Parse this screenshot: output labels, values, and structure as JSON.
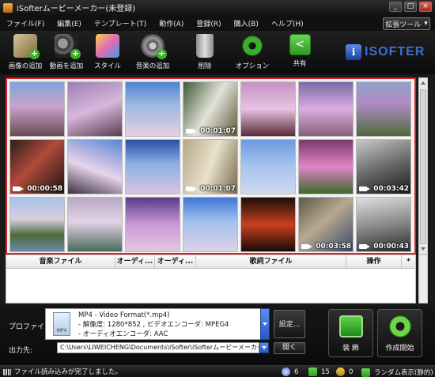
{
  "window": {
    "title": "iSofterムービーメーカー(未登録)",
    "minimize": "_",
    "maximize": "□",
    "close": "×"
  },
  "menu": [
    "ファイル(F)",
    "編集(E)",
    "テンプレート(T)",
    "動作(A)",
    "登録(R)",
    "購入(B)",
    "ヘルプ(H)"
  ],
  "ext_tools": {
    "label": "拡張ツール",
    "arrow": "▾"
  },
  "toolbar": [
    {
      "label": "画像の追加",
      "icon": "add-image-icon"
    },
    {
      "label": "動画を追加",
      "icon": "add-video-icon"
    },
    {
      "label": "スタイル",
      "icon": "style-icon"
    },
    {
      "label": "音楽の追加",
      "icon": "add-music-icon"
    },
    {
      "label": "削除",
      "icon": "trash-icon"
    },
    {
      "label": "オプション",
      "icon": "gear-icon"
    },
    {
      "label": "共有",
      "icon": "share-icon"
    }
  ],
  "logo": {
    "badge": "i",
    "text": "ISOFTER"
  },
  "media": [
    [
      {
        "type": "image",
        "duration": ""
      },
      {
        "type": "image",
        "duration": ""
      },
      {
        "type": "image",
        "duration": ""
      },
      {
        "type": "video",
        "duration": "00:01:07"
      },
      {
        "type": "image",
        "duration": ""
      },
      {
        "type": "image",
        "duration": ""
      },
      {
        "type": "image",
        "duration": ""
      }
    ],
    [
      {
        "type": "video",
        "duration": "00:00:58"
      },
      {
        "type": "image",
        "duration": ""
      },
      {
        "type": "image",
        "duration": ""
      },
      {
        "type": "video",
        "duration": "00:01:07"
      },
      {
        "type": "image",
        "duration": ""
      },
      {
        "type": "image",
        "duration": ""
      },
      {
        "type": "video",
        "duration": "00:03:42"
      }
    ],
    [
      {
        "type": "image",
        "duration": ""
      },
      {
        "type": "image",
        "duration": ""
      },
      {
        "type": "image",
        "duration": ""
      },
      {
        "type": "image",
        "duration": ""
      },
      {
        "type": "image",
        "duration": ""
      },
      {
        "type": "video",
        "duration": "00:03:58"
      },
      {
        "type": "video",
        "duration": "00:00:43"
      }
    ]
  ],
  "music_table": {
    "columns": [
      "音楽ファイル",
      "オーディ...",
      "オーディ...",
      "歌詞ファイル",
      "操作",
      "*"
    ]
  },
  "profile": {
    "label": "プロファイル:",
    "lines": [
      "MP4 - Video Format(*.mp4)",
      "- 解像度: 1280*852 , ビデオエンコーダ: MPEG4",
      "- オーディオエンコーダ: AAC"
    ],
    "icon_text": "MP4",
    "settings_label": "設定..."
  },
  "output": {
    "label": "出力先:",
    "path": "C:\\Users\\LIWEICHENG\\Documents\\iSofter\\iSofterムービーメーカー出力\\",
    "open_label": "開く"
  },
  "actions": {
    "decorate": "装 飾",
    "start": "作成開始"
  },
  "status": {
    "message": "ファイル読み込みが完了しました。",
    "count_a": "6",
    "count_b": "15",
    "count_c": "0",
    "mode": "ランダム表示(静的)"
  },
  "colors": {
    "selection_border": "#d32020",
    "accent_blue": "#2458c4",
    "plus_green": "#3fae2a"
  }
}
